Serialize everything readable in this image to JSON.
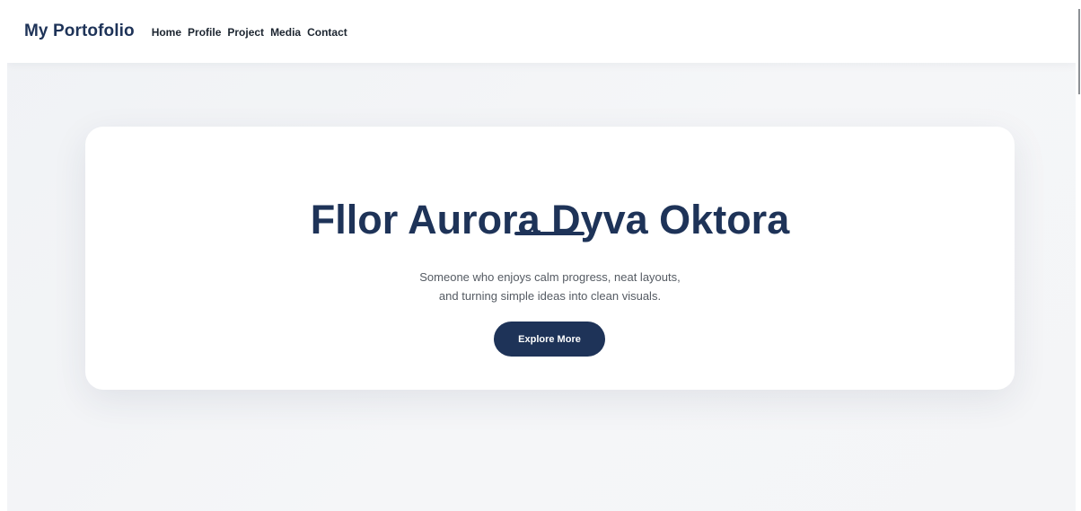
{
  "navbar": {
    "brand": "My Portofolio",
    "links": [
      {
        "label": "Home"
      },
      {
        "label": "Profile"
      },
      {
        "label": "Project"
      },
      {
        "label": "Media"
      },
      {
        "label": "Contact"
      }
    ]
  },
  "hero": {
    "title": "Fllor Aurora Dyva Oktora",
    "subtitle_lines": [
      "Someone who enjoys calm progress, neat layouts,",
      "and turning simple ideas into clean visuals."
    ],
    "button_label": "Explore More"
  },
  "colors": {
    "brand_navy": "#1e3358",
    "page_background": "#f2f4f6",
    "card_background": "#ffffff",
    "nav_text": "#1c2530",
    "subtitle_text": "#555b63"
  }
}
